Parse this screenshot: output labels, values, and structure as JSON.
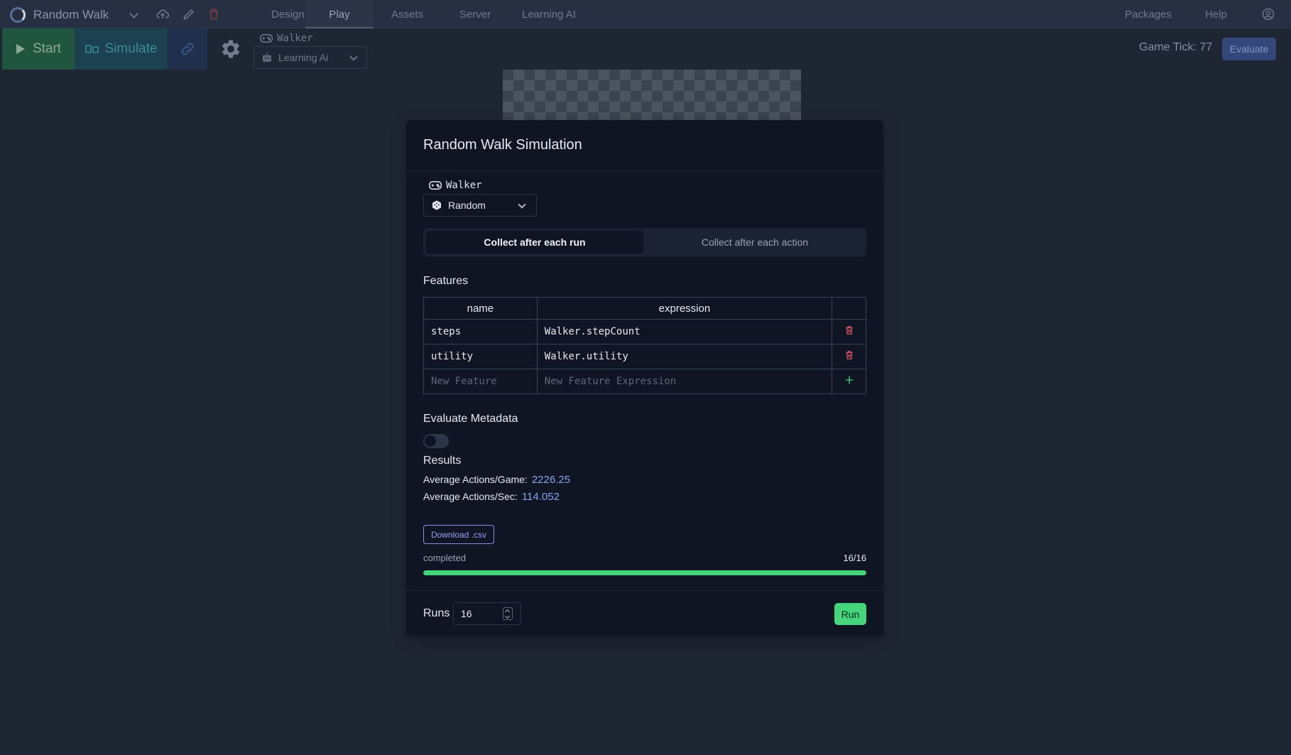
{
  "app": {
    "title": "Random Walk",
    "nav": [
      {
        "label": "Design"
      },
      {
        "label": "Play"
      },
      {
        "label": "Assets"
      },
      {
        "label": "Server"
      },
      {
        "label": "Learning AI"
      }
    ],
    "nav_right": [
      {
        "label": "Packages"
      },
      {
        "label": "Help"
      }
    ]
  },
  "toolbar": {
    "start_label": "Start",
    "simulate_label": "Simulate",
    "player_name": "Walker",
    "ai_value": "Learning Ai",
    "game_tick_label": "Game Tick: 77",
    "evaluate_label": "Evaluate"
  },
  "modal": {
    "title": "Random Walk Simulation",
    "player_name": "Walker",
    "agent_value": "Random",
    "collect_options": [
      "Collect after each run",
      "Collect after each action"
    ],
    "collect_selected": "Collect after each run",
    "features_title": "Features",
    "features_columns": [
      "name",
      "expression"
    ],
    "features": [
      {
        "name": "steps",
        "expression": "Walker.stepCount"
      },
      {
        "name": "utility",
        "expression": "Walker.utility"
      }
    ],
    "new_feature_placeholder": "New Feature",
    "new_expression_placeholder": "New Feature Expression",
    "metadata_title": "Evaluate Metadata",
    "metadata_enabled": false,
    "results_title": "Results",
    "avg_actions_game_label": "Average Actions/Game:",
    "avg_actions_game_value": "2226.25",
    "avg_actions_sec_label": "Average Actions/Sec:",
    "avg_actions_sec_value": "114.052",
    "download_label": "Download .csv",
    "progress_label": "completed",
    "progress_count": "16/16",
    "progress_fraction": 1.0,
    "runs_label": "Runs",
    "runs_value": "16",
    "run_label": "Run"
  },
  "colors": {
    "accent_green": "#45d57c",
    "accent_blue": "#8aa4ee",
    "delete_red": "#e0566d",
    "background": "#1f2633",
    "modal_bg": "#0f1523"
  }
}
